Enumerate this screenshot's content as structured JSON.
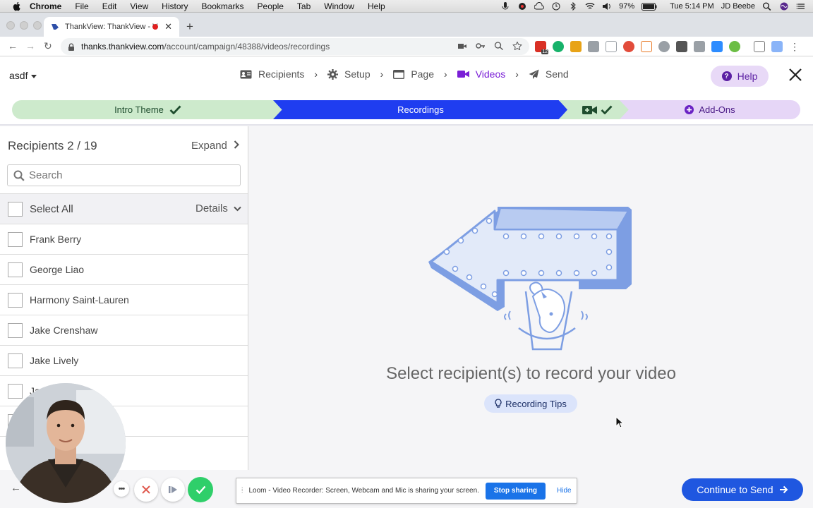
{
  "menubar": {
    "app": "Chrome",
    "items": [
      "File",
      "Edit",
      "View",
      "History",
      "Bookmarks",
      "People",
      "Tab",
      "Window",
      "Help"
    ],
    "battery": "97%",
    "clock": "Tue 5:14 PM",
    "user": "JD Beebe"
  },
  "browser": {
    "tab_title": "ThankView: ThankView - V",
    "url_host": "thanks.thankview.com",
    "url_path": "/account/campaign/48388/videos/recordings",
    "extension_badge": "12"
  },
  "header": {
    "campaign": "asdf",
    "steps": [
      {
        "label": "Recipients",
        "icon": "address-card-icon"
      },
      {
        "label": "Setup",
        "icon": "gear-icon"
      },
      {
        "label": "Page",
        "icon": "window-icon"
      },
      {
        "label": "Videos",
        "icon": "video-camera-icon"
      },
      {
        "label": "Send",
        "icon": "paper-plane-icon"
      }
    ],
    "help": "Help"
  },
  "progress": {
    "intro": "Intro Theme",
    "recordings": "Recordings",
    "addons": "Add-Ons"
  },
  "recipients": {
    "title": "Recipients 2 / 19",
    "expand": "Expand",
    "search_placeholder": "Search",
    "select_all": "Select All",
    "details": "Details",
    "list": [
      "Frank Berry",
      "George Liao",
      "Harmony Saint-Lauren",
      "Jake Crenshaw",
      "Jake Lively",
      "Ja",
      "",
      ""
    ]
  },
  "main": {
    "message": "Select recipient(s) to record your video",
    "tips": "Recording Tips"
  },
  "loom": {
    "message": "Loom - Video Recorder: Screen, Webcam and Mic is sharing your screen.",
    "stop": "Stop sharing",
    "hide": "Hide"
  },
  "footer": {
    "continue": "Continue to Send"
  },
  "colors": {
    "accent_purple": "#7a1fd6",
    "progress_blue": "#1f3df0",
    "progress_green": "#cdeacc",
    "progress_lavender": "#e6d6f7",
    "button_blue": "#1f57e0"
  }
}
